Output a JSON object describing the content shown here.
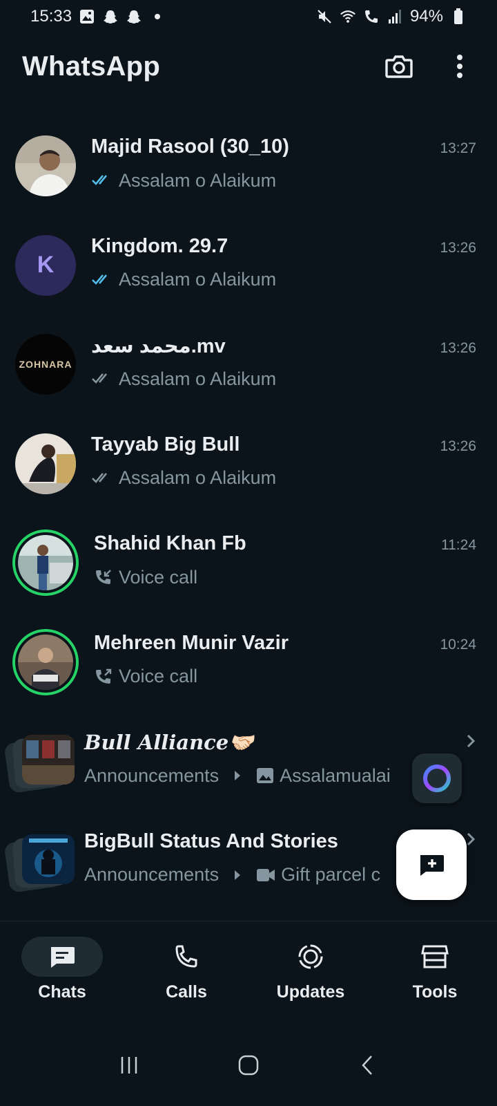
{
  "status_bar": {
    "time": "15:33",
    "battery": "94%"
  },
  "app_bar": {
    "title": "WhatsApp"
  },
  "chats": [
    {
      "name": "Majid Rasool (30_10)",
      "time": "13:27",
      "preview": "Assalam o Alaikum",
      "ticks": "read"
    },
    {
      "name": "Kingdom. 29.7",
      "time": "13:26",
      "preview": "Assalam o Alaikum",
      "ticks": "read",
      "avatar_letter": "K"
    },
    {
      "name": "محمد سعد.mv",
      "time": "13:26",
      "preview": "Assalam o Alaikum",
      "ticks": "delivered",
      "avatar_text": "ZOHNARA"
    },
    {
      "name": "Tayyab Big Bull",
      "time": "13:26",
      "preview": "Assalam o Alaikum",
      "ticks": "delivered"
    },
    {
      "name": "Shahid Khan Fb",
      "time": "11:24",
      "preview": "Voice call",
      "call": "incoming"
    },
    {
      "name": "Mehreen Munir Vazir",
      "time": "10:24",
      "preview": "Voice call",
      "call": "outgoing"
    }
  ],
  "communities": [
    {
      "name": "Bull Alliance🤝🏻",
      "group": "Announcements",
      "preview": "Assalamualai",
      "media": "image"
    },
    {
      "name": "BigBull Status And Stories",
      "group": "Announcements",
      "preview": "Gift parcel c",
      "media": "video"
    }
  ],
  "bottom_nav": [
    {
      "label": "Chats",
      "icon": "chats-icon",
      "active": true
    },
    {
      "label": "Calls",
      "icon": "phone-icon",
      "active": false
    },
    {
      "label": "Updates",
      "icon": "updates-icon",
      "active": false
    },
    {
      "label": "Tools",
      "icon": "store-icon",
      "active": false
    }
  ],
  "colors": {
    "background": "#0b141a",
    "accent_green": "#25d366",
    "read_tick": "#53bdeb",
    "secondary_text": "#8696a0"
  }
}
